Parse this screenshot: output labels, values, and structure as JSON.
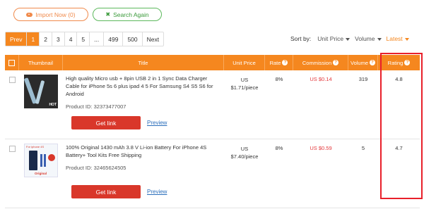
{
  "toolbar": {
    "import_label": "Import Now (0)",
    "search_again_label": "Search Again"
  },
  "pagination": {
    "prev": "Prev",
    "pages": [
      "1",
      "2",
      "3",
      "4",
      "5",
      "...",
      "499",
      "500"
    ],
    "current": "1",
    "next": "Next"
  },
  "sort": {
    "label": "Sort by:",
    "options": [
      "Unit Price",
      "Volume",
      "Latest"
    ],
    "active": "Latest"
  },
  "table": {
    "headers": {
      "thumbnail": "Thumbnail",
      "title": "Title",
      "unit_price": "Unit Price",
      "rate": "Rate",
      "commission": "Commission",
      "volume": "Volume",
      "rating": "Rating"
    },
    "rows": [
      {
        "title": "High quality Micro usb + 8pin USB 2 in 1 Sync Data Charger Cable for iPhone 5s 6 plus ipad 4 5 For Samsung S4 S5 S6 for Android",
        "product_id": "Product ID: 32373477007",
        "price_currency": "US",
        "price_value": "$1.71/piece",
        "rate": "8%",
        "commission": "US $0.14",
        "volume": "319",
        "rating": "4.8",
        "thumb_text": "HOT",
        "get_link": "Get link",
        "preview": "Preview"
      },
      {
        "title": "100% Original 1430 mAh 3.8 V Li-ion Battery For iPhone 4S Battery+ Tool Kits Free Shipping",
        "product_id": "Product ID: 32465624505",
        "price_currency": "US",
        "price_value": "$7.40/piece",
        "rate": "8%",
        "commission": "US $0.59",
        "volume": "5",
        "rating": "4.7",
        "thumb_text_top": "For iphone 4S",
        "thumb_text_bottom": "Original",
        "get_link": "Get link",
        "preview": "Preview"
      }
    ]
  },
  "colors": {
    "accent": "#f5871f",
    "get_link": "#d9372a",
    "commission": "#e4393c",
    "highlight": "#e8202a",
    "search_green": "#5cb85c"
  }
}
